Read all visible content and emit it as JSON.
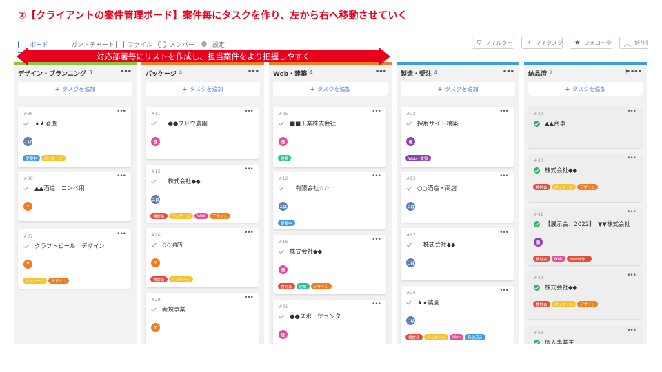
{
  "slide_title": "②【クライアントの案件管理ボード】案件毎にタスクを作り、左から右へ移動させていく",
  "annotation": "対応部署毎にリストを作成し、担当案件をより把握しやすく",
  "nav": {
    "tabs": [
      {
        "label": "ボード",
        "icon": "board-icon"
      },
      {
        "label": "ガントチャート",
        "icon": "gantt-icon"
      },
      {
        "label": "ファイル",
        "icon": "file-icon"
      },
      {
        "label": "メンバー",
        "icon": "member-icon"
      },
      {
        "label": "設定",
        "icon": "gear-icon"
      }
    ],
    "buttons": [
      {
        "label": "フィルター",
        "icon": "filter-icon"
      },
      {
        "label": "マイタスク",
        "icon": "check-icon"
      },
      {
        "label": "フォロー中",
        "icon": "star-icon"
      },
      {
        "label": "折り畳む",
        "icon": "chevron-up-icon"
      }
    ]
  },
  "add_task_label": "タスクを追加",
  "columns": [
    {
      "title": "デザイン・ブランニング",
      "count": "3",
      "color": "#8cc63f",
      "cards": [
        {
          "num": "#36",
          "title": "★★酒造",
          "avatar": "こば",
          "avatar_color": "#5b7fb5",
          "tags": [
            {
              "t": "提案中",
              "c": "#3a9ee0"
            },
            {
              "t": "パッケージ",
              "c": "#f4c430"
            }
          ]
        },
        {
          "num": "#38",
          "title": "▲▲酒造　コンペ用",
          "avatar": "Y",
          "avatar_color": "#f07d22",
          "tags": []
        },
        {
          "num": "#37",
          "title": "クラフトビール　デザイン",
          "avatar": "Y",
          "avatar_color": "#f07d22",
          "tags": [
            {
              "t": "パッケージ",
              "c": "#f4c430"
            },
            {
              "t": "デザイン",
              "c": "#f07d22"
            }
          ]
        }
      ]
    },
    {
      "title": "パッケージ",
      "count": "4",
      "color": "#f07d22",
      "cards": [
        {
          "num": "#11",
          "title": "　●●ブドウ農園",
          "avatar": "佳",
          "avatar_color": "#e64e9b",
          "tags": []
        },
        {
          "num": "#15",
          "title": "　株式会社◆◆",
          "avatar": "こば",
          "avatar_color": "#5b7fb5",
          "tags": [
            {
              "t": "検討会",
              "c": "#e74c3c"
            },
            {
              "t": "パッケージ",
              "c": "#f4c430"
            },
            {
              "t": "Web",
              "c": "#e64e9b"
            },
            {
              "t": "デザイン",
              "c": "#f07d22"
            }
          ]
        },
        {
          "num": "#20",
          "title": "◇◇酒店",
          "avatar": "Y",
          "avatar_color": "#f07d22",
          "tags": [
            {
              "t": "検討会",
              "c": "#e74c3c"
            },
            {
              "t": "パッケージ",
              "c": "#f4c430"
            }
          ]
        },
        {
          "num": "#29",
          "title": "新規事業",
          "avatar": "Y",
          "avatar_color": "#f07d22",
          "tags": []
        }
      ]
    },
    {
      "title": "Web・建築",
      "count": "4",
      "color": "#f07d22",
      "cards": [
        {
          "num": "#25",
          "title": "■■工業株式会社",
          "avatar": "佳",
          "avatar_color": "#e64e9b",
          "tags": [
            {
              "t": "建築",
              "c": "#2ebf91"
            }
          ]
        },
        {
          "num": "#12",
          "title": "　有限会社☆☆",
          "avatar": "こば",
          "avatar_color": "#5b7fb5",
          "tags": [
            {
              "t": "提案中",
              "c": "#3a9ee0"
            }
          ]
        },
        {
          "num": "#16",
          "title": "株式会社◆◆",
          "avatar": "佳",
          "avatar_color": "#e64e9b",
          "tags": [
            {
              "t": "検討会",
              "c": "#e74c3c"
            },
            {
              "t": "建築",
              "c": "#2ebf91"
            },
            {
              "t": "デザイン",
              "c": "#f07d22"
            }
          ]
        },
        {
          "num": "#21",
          "title": "●●スポーツセンター",
          "avatar": "佳",
          "avatar_color": "#e64e9b",
          "tags": []
        }
      ]
    },
    {
      "title": "製造・受注",
      "count": "4",
      "color": "#3a9ee0",
      "cards": [
        {
          "num": "#22",
          "title": "採用サイト構築",
          "avatar": "徳",
          "avatar_color": "#8e44ad",
          "tags": [
            {
              "t": "Web・受振",
              "c": "#8e44ad"
            }
          ]
        },
        {
          "num": "#13",
          "title": "○○酒造・商店",
          "avatar": "こば",
          "avatar_color": "#5b7fb5",
          "tags": []
        },
        {
          "num": "#17",
          "title": "　株式会社◆◆",
          "avatar": "こば",
          "avatar_color": "#5b7fb5",
          "tags": []
        },
        {
          "num": "#26",
          "title": "★★農園",
          "avatar": "こば",
          "avatar_color": "#5b7fb5",
          "tags": [
            {
              "t": "検討会",
              "c": "#e74c3c"
            },
            {
              "t": "パッケージ",
              "c": "#f4c430"
            },
            {
              "t": "Web",
              "c": "#e64e9b"
            },
            {
              "t": "発送済み",
              "c": "#3a9ee0"
            }
          ]
        }
      ]
    },
    {
      "title": "納品済",
      "count": "7",
      "color": "#3a9ee0",
      "cards": [
        {
          "num": "#39",
          "title": "▲▲商事",
          "avatar": "",
          "avatar_color": "",
          "tags": []
        },
        {
          "num": "#40",
          "title": "株式会社◆◆",
          "avatar": "",
          "avatar_color": "",
          "tags": [
            {
              "t": "検討会",
              "c": "#e74c3c"
            },
            {
              "t": "パッケージ",
              "c": "#f4c430"
            },
            {
              "t": "デザイン",
              "c": "#f07d22"
            }
          ]
        },
        {
          "num": "#41",
          "title": "【展示会：2022】　▼▼株式会社",
          "avatar": "徳",
          "avatar_color": "#8e44ad",
          "tags": [
            {
              "t": "検討会",
              "c": "#e74c3c"
            },
            {
              "t": "Web",
              "c": "#e64e9b"
            },
            {
              "t": "Web制作...",
              "c": "#e74c3c"
            }
          ]
        },
        {
          "num": "#42",
          "title": "株式会社◆◆",
          "avatar": "",
          "avatar_color": "",
          "tags": [
            {
              "t": "検討会",
              "c": "#e74c3c"
            },
            {
              "t": "パッケージ",
              "c": "#f4c430"
            },
            {
              "t": "デザイン",
              "c": "#f07d22"
            }
          ]
        },
        {
          "num": "#43",
          "title": "個人事業主",
          "avatar": "",
          "avatar_color": "",
          "tags": []
        }
      ]
    }
  ]
}
